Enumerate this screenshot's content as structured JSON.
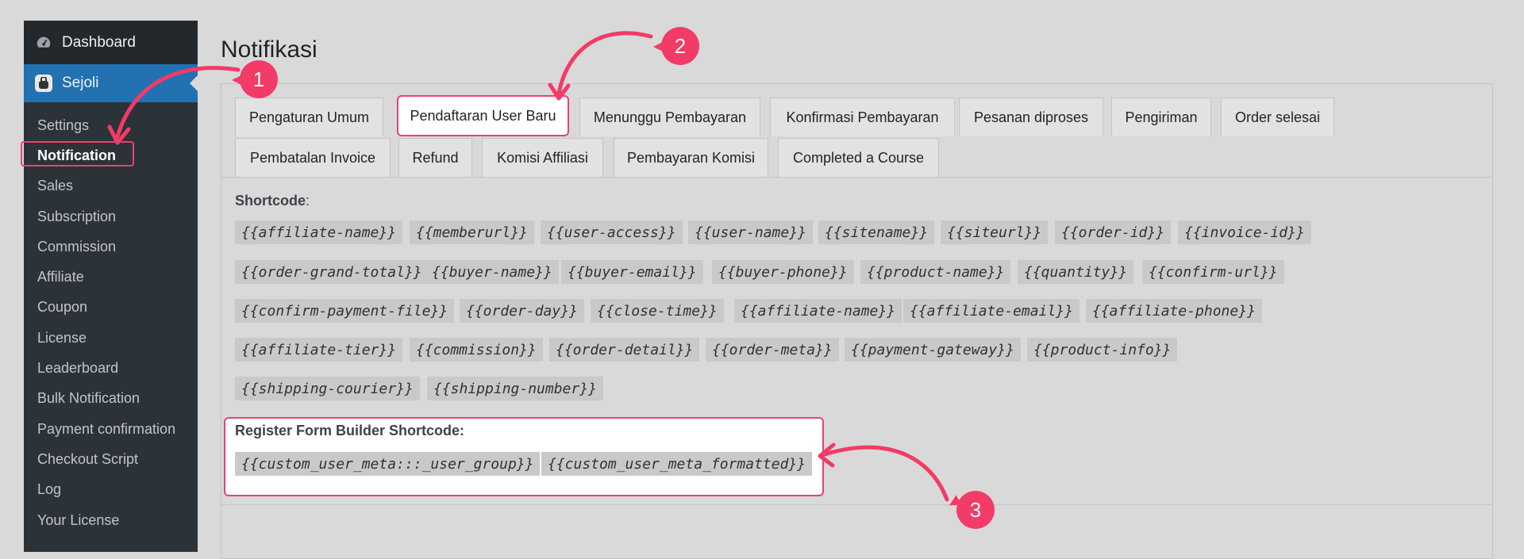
{
  "sidebar": {
    "top_items": [
      {
        "label": "Dashboard",
        "icon": "dashboard-icon"
      },
      {
        "label": "Sejoli",
        "icon": "sejoli-icon"
      }
    ],
    "submenu": [
      {
        "label": "Settings"
      },
      {
        "label": "Notification",
        "current": true
      },
      {
        "label": "Sales"
      },
      {
        "label": "Subscription"
      },
      {
        "label": "Commission"
      },
      {
        "label": "Affiliate"
      },
      {
        "label": "Coupon"
      },
      {
        "label": "License"
      },
      {
        "label": "Leaderboard"
      },
      {
        "label": "Bulk Notification"
      },
      {
        "label": "Payment confirmation"
      },
      {
        "label": "Checkout Script"
      },
      {
        "label": "Log"
      },
      {
        "label": "Your License"
      }
    ]
  },
  "page": {
    "title": "Notifikasi"
  },
  "tabs": [
    "Pengaturan Umum",
    "Pendaftaran User Baru",
    "Menunggu Pembayaran",
    "Konfirmasi Pembayaran",
    "Pesanan diproses",
    "Pengiriman",
    "Order selesai",
    "Pembatalan Invoice",
    "Refund",
    "Komisi Affiliasi",
    "Pembayaran Komisi",
    "Completed a Course"
  ],
  "active_tab": "Pendaftaran User Baru",
  "shortcode": {
    "label": "Shortcode",
    "colon": ":",
    "codes": [
      "{{affiliate-name}}",
      "{{memberurl}}",
      "{{user-access}}",
      "{{user-name}}",
      "{{sitename}}",
      "{{siteurl}}",
      "{{order-id}}",
      "{{invoice-id}}",
      "{{order-grand-total}}",
      "{{buyer-name}}",
      "{{buyer-email}}",
      "{{buyer-phone}}",
      "{{product-name}}",
      "{{quantity}}",
      "{{confirm-url}}",
      "{{confirm-payment-file}}",
      "{{order-day}}",
      "{{close-time}}",
      "{{affiliate-name}}",
      "{{affiliate-email}}",
      "{{affiliate-phone}}",
      "{{affiliate-tier}}",
      "{{commission}}",
      "{{order-detail}}",
      "{{order-meta}}",
      "{{payment-gateway}}",
      "{{product-info}}",
      "{{shipping-courier}}",
      "{{shipping-number}}"
    ]
  },
  "register_form": {
    "label": "Register Form Builder Shortcode:",
    "codes": [
      "{{custom_user_meta:::_user_group}}",
      "{{custom_user_meta_formatted}}"
    ]
  },
  "callouts": [
    "1",
    "2",
    "3"
  ],
  "colors": {
    "accent": "#f23b66",
    "sidebar_bg": "#23282d",
    "active_menu": "#2271b1"
  }
}
